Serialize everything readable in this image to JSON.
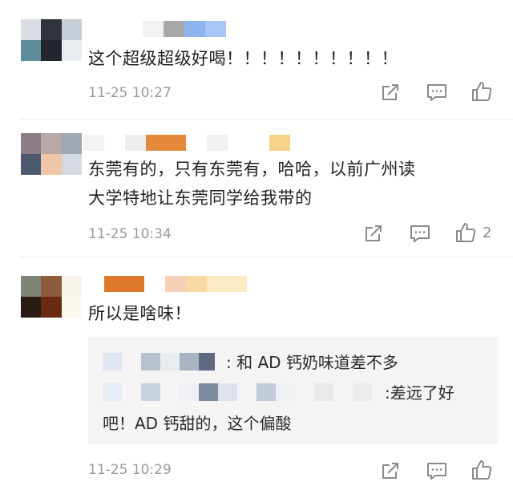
{
  "comments": [
    {
      "text": "这个超级超级好喝！！！！！！！！！！",
      "time": "11-25 10:27",
      "likes": ""
    },
    {
      "text": "东莞有的，只有东莞有，哈哈，以前广州读大学特地让东莞同学给我带的",
      "line1": "东莞有的，只有东莞有，哈哈，以前广州读",
      "line2": "大学特地让东莞同学给我带的",
      "time": "11-25 10:34",
      "likes": "2"
    },
    {
      "text": "所以是啥味！",
      "time": "11-25 10:29",
      "likes": "",
      "replies": [
        {
          "text": ": 和 AD 钙奶味道差不多"
        },
        {
          "text_part1": ":差远了好",
          "text_part2": "吧！AD 钙甜的，这个偏酸"
        }
      ]
    }
  ],
  "icons": {
    "share": "share-icon",
    "comment": "comment-icon",
    "like": "thumbs-up-icon"
  },
  "colors": {
    "text": "#1f1f1f",
    "meta": "#9a9a9a",
    "reply_bg": "#f4f4f4",
    "icon": "#8a8a8a"
  }
}
